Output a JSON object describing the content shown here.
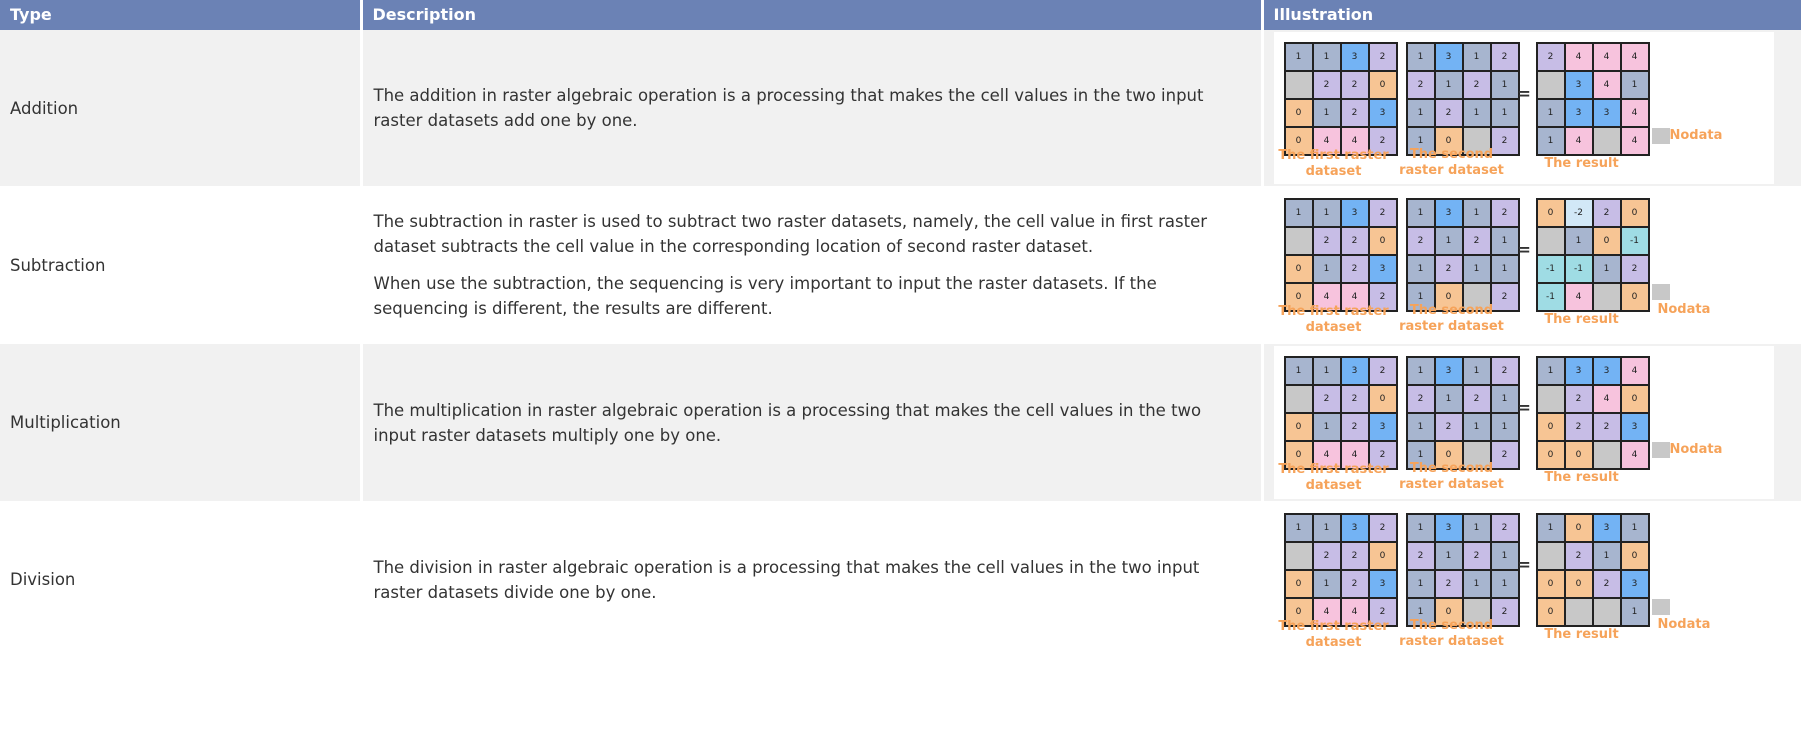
{
  "header": {
    "type": "Type",
    "description": "Description",
    "illustration": "Illustration"
  },
  "colors": {
    "header_bg": "#6b82b5",
    "cell_gray_blue": "#a7b5cf",
    "cell_blue": "#73b3f4",
    "cell_purple": "#c7bde6",
    "cell_orange": "#f7c594",
    "cell_pink": "#f7c3dd",
    "cell_nodata": "#c8c8c8",
    "cell_cyan": "#9fdce4",
    "cell_lightblue": "#d2e8f7",
    "caption": "#f6a35a"
  },
  "captions": {
    "first": "The first raster dataset",
    "second": "The second raster dataset",
    "result": "The result",
    "nodata": "Nodata",
    "equals": "="
  },
  "rows": [
    {
      "type": "Addition",
      "description": [
        "The addition in raster algebraic operation is a processing that makes the cell values in the two input raster datasets add one by one."
      ],
      "result": [
        [
          "2",
          "4",
          "4",
          "4"
        ],
        [
          "",
          "3",
          "4",
          "1"
        ],
        [
          "1",
          "3",
          "3",
          "4"
        ],
        [
          "1",
          "4",
          "",
          "4"
        ]
      ]
    },
    {
      "type": "Subtraction",
      "description": [
        "The subtraction in raster is used to subtract two raster datasets, namely, the cell value in first raster dataset subtracts the cell value in the corresponding location of second raster dataset.",
        "When use the subtraction, the sequencing is very important to input the raster datasets. If the sequencing is different, the results are different."
      ],
      "result": [
        [
          "0",
          "-2",
          "2",
          "0"
        ],
        [
          "",
          "1",
          "0",
          "-1"
        ],
        [
          "-1",
          "-1",
          "1",
          "2"
        ],
        [
          "-1",
          "4",
          "",
          "0"
        ]
      ]
    },
    {
      "type": "Multiplication",
      "description": [
        "The multiplication in raster algebraic operation is a processing that makes the cell values in the two input raster datasets multiply one by one."
      ],
      "result": [
        [
          "1",
          "3",
          "3",
          "4"
        ],
        [
          "",
          "2",
          "4",
          "0"
        ],
        [
          "0",
          "2",
          "2",
          "3"
        ],
        [
          "0",
          "0",
          "",
          "4"
        ]
      ]
    },
    {
      "type": "Division",
      "description": [
        "The division in raster algebraic operation is a processing that makes the cell values in the two input raster datasets divide one by one."
      ],
      "result": [
        [
          "1",
          "0",
          "3",
          "1"
        ],
        [
          "",
          "2",
          "1",
          "0"
        ],
        [
          "0",
          "0",
          "2",
          "3"
        ],
        [
          "0",
          "",
          "",
          "1"
        ]
      ]
    }
  ],
  "first_grid": [
    [
      "1",
      "1",
      "3",
      "2"
    ],
    [
      "",
      "2",
      "2",
      "0"
    ],
    [
      "0",
      "1",
      "2",
      "3"
    ],
    [
      "0",
      "4",
      "4",
      "2"
    ]
  ],
  "second_grid": [
    [
      "1",
      "3",
      "1",
      "2"
    ],
    [
      "2",
      "1",
      "2",
      "1"
    ],
    [
      "1",
      "2",
      "1",
      "1"
    ],
    [
      "1",
      "0",
      "",
      "2"
    ]
  ]
}
